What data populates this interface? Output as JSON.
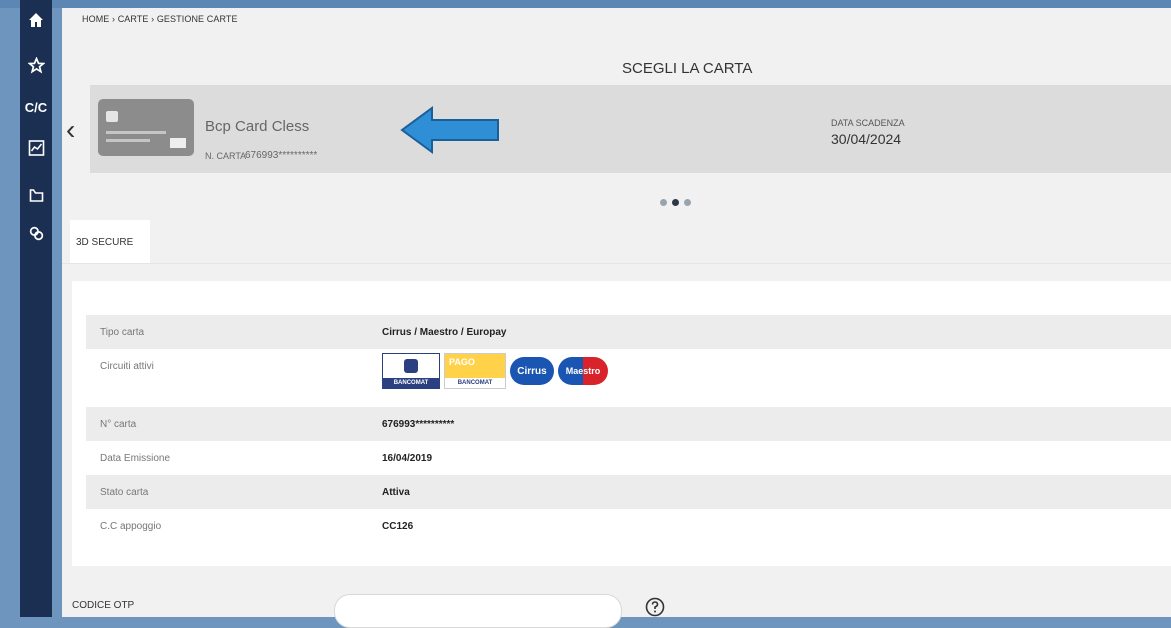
{
  "breadcrumb": "HOME › CARTE › GESTIONE CARTE",
  "title": "SCEGLI LA CARTA",
  "sidebar": {
    "items": [
      {
        "icon": "home-icon"
      },
      {
        "icon": "star-icon"
      },
      {
        "label": "C/C"
      },
      {
        "icon": "chart-icon"
      },
      {
        "icon": "folder-icon"
      },
      {
        "icon": "link-icon"
      }
    ]
  },
  "card": {
    "name": "Bcp Card Cless",
    "number_label": "N. CARTA",
    "number": "676993**********",
    "expiry_label": "DATA SCADENZA",
    "expiry": "30/04/2024"
  },
  "tabs": [
    {
      "label": "3D SECURE"
    }
  ],
  "details": {
    "rows": [
      {
        "label": "Tipo carta",
        "value": "Cirrus / Maestro / Europay"
      },
      {
        "label": "Circuiti attivi",
        "value": ""
      },
      {
        "label": "N° carta",
        "value": "676993**********"
      },
      {
        "label": "Data Emissione",
        "value": "16/04/2019"
      },
      {
        "label": "Stato carta",
        "value": "Attiva"
      },
      {
        "label": "C.C appoggio",
        "value": "CC126"
      }
    ],
    "logos": {
      "bancomat": "BANCOMAT",
      "pago_top": "PAGO",
      "pago_bottom": "BANCOMAT",
      "cirrus": "Cirrus",
      "maestro": "Maestro"
    }
  },
  "otp": {
    "label": "CODICE OTP",
    "value": ""
  },
  "colors": {
    "sidebar": "#1b2f52",
    "arrow": "#2f8fd6",
    "background": "#6d95bd"
  }
}
